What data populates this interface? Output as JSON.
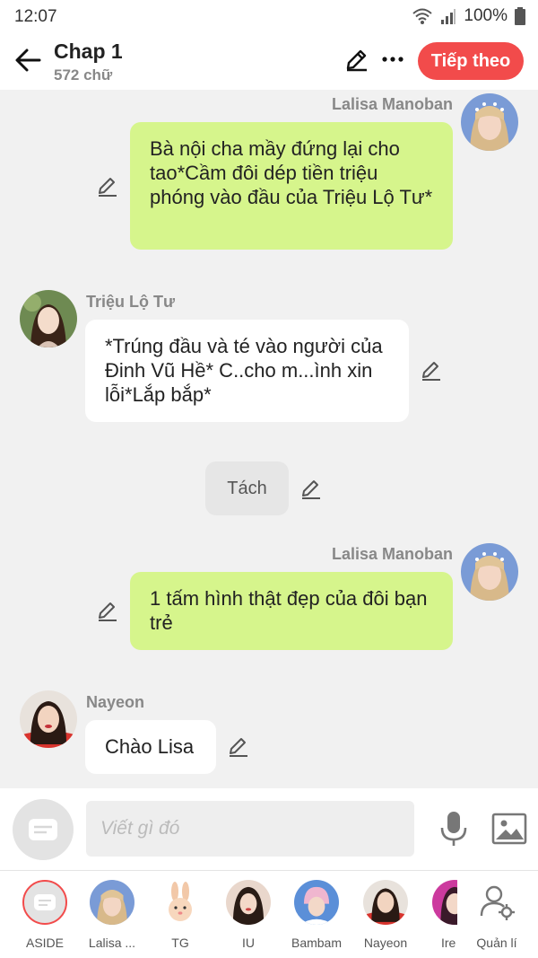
{
  "status_bar": {
    "time": "12:07",
    "battery": "100%"
  },
  "header": {
    "title": "Chap 1",
    "subtitle": "572 chữ",
    "next_label": "Tiếp theo"
  },
  "messages": [
    {
      "sender": "Lalisa Manoban",
      "text": "Bà nội cha mầy đứng lại cho tao*Cầm đôi dép tiền triệu phóng vào đầu của Triệu Lộ Tư*"
    },
    {
      "sender": "Triệu Lộ Tư",
      "text": "*Trúng đầu và té vào người của Đinh Vũ Hề* C..cho m...ình xin lỗi*Lắp bắp*"
    },
    {
      "sender": "",
      "text": "Tách"
    },
    {
      "sender": "Lalisa Manoban",
      "text": "1 tấm hình thật đẹp của đôi bạn trẻ"
    },
    {
      "sender": "Nayeon",
      "text": "Chào Lisa"
    }
  ],
  "composer": {
    "placeholder": "Viết gì đó"
  },
  "characters": [
    {
      "label": "ASIDE"
    },
    {
      "label": "Lalisa ..."
    },
    {
      "label": "TG"
    },
    {
      "label": "IU"
    },
    {
      "label": "Bambam"
    },
    {
      "label": "Nayeon"
    },
    {
      "label": "Ire"
    },
    {
      "label": "Quản lí"
    }
  ],
  "colors": {
    "accent": "#f24b4b",
    "bubble_green": "#d6f58c",
    "bubble_white": "#ffffff",
    "bubble_gray": "#e6e6e6"
  }
}
